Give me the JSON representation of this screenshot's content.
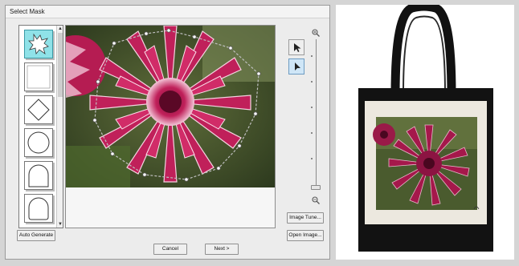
{
  "dialog": {
    "title": "Select Mask",
    "shape_list": {
      "items": [
        {
          "name": "flower-mask",
          "selected": true
        },
        {
          "name": "square-mask",
          "selected": false
        },
        {
          "name": "diamond-mask",
          "selected": false
        },
        {
          "name": "circle-mask",
          "selected": false
        },
        {
          "name": "arch-mask",
          "selected": false
        },
        {
          "name": "rounded-arch-mask",
          "selected": false
        }
      ]
    },
    "tools": [
      {
        "name": "select-arrow-icon",
        "active": false
      },
      {
        "name": "node-edit-arrow-icon",
        "active": true
      }
    ],
    "zoom": {
      "in_icon": "zoom-in-icon",
      "out_icon": "zoom-out-icon",
      "level": 0.02
    },
    "buttons": {
      "auto_generate": "Auto Generate",
      "image_tune": "Image Tune...",
      "open_image": "Open Image...",
      "cancel": "Cancel",
      "next": "Next >"
    },
    "colors": {
      "selection_cyan": "#8fe2e8",
      "dahlia_magenta": "#c0205a"
    }
  },
  "product": {
    "description_icon": "tote-bag",
    "bag_color": "#121212",
    "panel_color": "#ece8df"
  }
}
